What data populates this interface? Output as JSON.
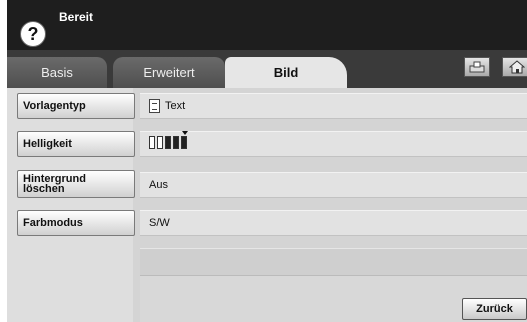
{
  "header": {
    "status": "Bereit",
    "help_glyph": "?"
  },
  "tabs": [
    {
      "label": "Basis",
      "active": false
    },
    {
      "label": "Erweitert",
      "active": false
    },
    {
      "label": "Bild",
      "active": true
    }
  ],
  "settings": [
    {
      "label": "Vorlagentyp",
      "value": "Text",
      "icon": "document-icon"
    },
    {
      "label": "Helligkeit",
      "value_level": 4,
      "value_max": 5
    },
    {
      "label": "Hintergrund löschen",
      "value": "Aus"
    },
    {
      "label": "Farbmodus",
      "value": "S/W"
    }
  ],
  "footer": {
    "back_label": "Zurück"
  },
  "colors": {
    "title_bar": "#1e1e1e",
    "tab_bar": "#3a3a3a",
    "active_tab": "#e6e6e6",
    "content_bg": "#d4d4d4"
  }
}
